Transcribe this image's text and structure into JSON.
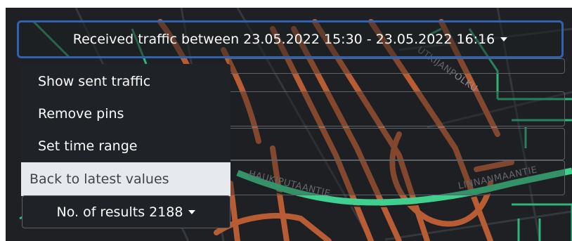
{
  "header": {
    "title": "Received traffic between 23.05.2022 15:30 - 23.05.2022 16:16"
  },
  "menu": {
    "items": [
      {
        "label": "Show sent traffic"
      },
      {
        "label": "Remove pins"
      },
      {
        "label": "Set time range"
      },
      {
        "label": "Back to latest values"
      }
    ]
  },
  "results": {
    "label": "No. of results 2188"
  },
  "map": {
    "streets": [
      "UTKIJANPOLKU",
      "HAUKIPUTAANTIE",
      "LINNANMAANTIE"
    ],
    "colors": {
      "background": "#1e2023",
      "road": "#c0643a",
      "green_road": "#3fcf8e",
      "minor_road": "#3a3d42"
    }
  },
  "icons": {
    "caret": "caret-down-icon"
  },
  "colors": {
    "accent": "#2f62b0",
    "menu_bg": "#1f2227",
    "active_bg": "#e6e9ee"
  }
}
